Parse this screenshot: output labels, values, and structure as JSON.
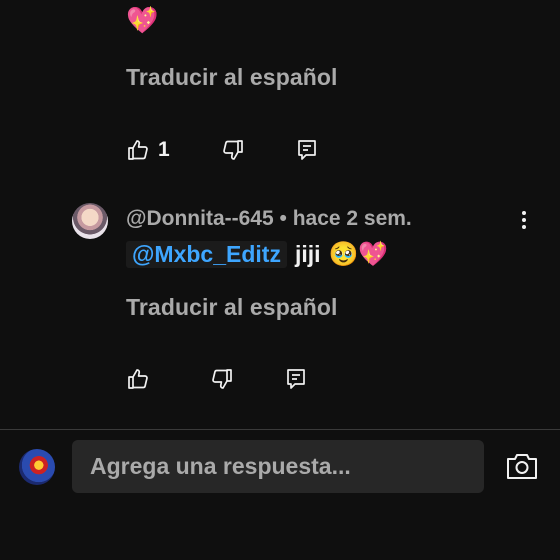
{
  "top_comment": {
    "emoji": "💖",
    "translate_label": "Traducir al español",
    "like_count": "1"
  },
  "reply": {
    "author": "@Donnita--645",
    "separator": " • ",
    "time": "hace 2 sem.",
    "mention": "@Mxbc_Editz",
    "text": "jiji",
    "emojis": "🥹💖",
    "translate_label": "Traducir al español"
  },
  "composer": {
    "placeholder": "Agrega una respuesta..."
  },
  "icons": {
    "like": "thumbs-up-icon",
    "dislike": "thumbs-down-icon",
    "reply": "reply-comment-icon",
    "more": "more-vert-icon",
    "camera": "camera-icon"
  },
  "colors": {
    "background": "#0f0f0f",
    "secondary_text": "#aaaaaa",
    "mention": "#3ea6ff",
    "input_bg": "#272727"
  }
}
